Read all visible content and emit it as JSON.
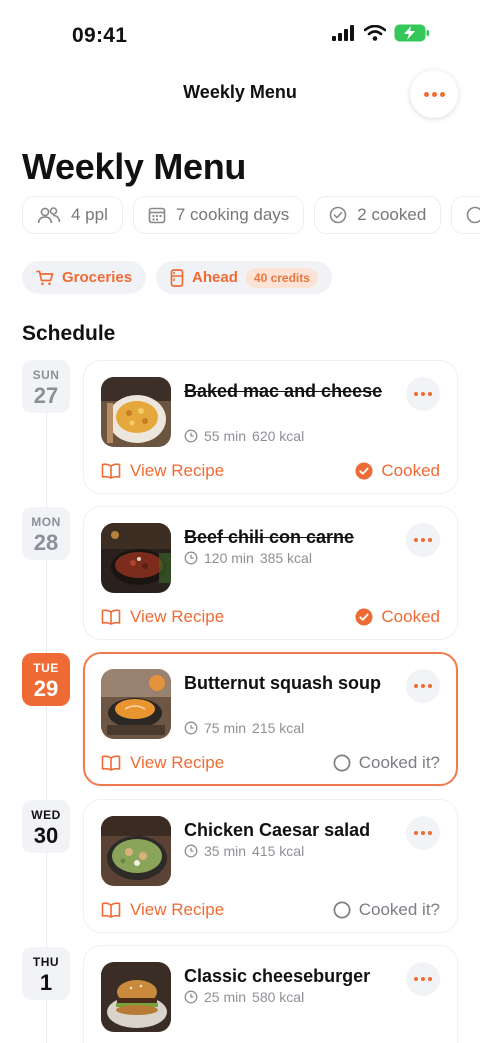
{
  "status_bar": {
    "time": "09:41"
  },
  "nav": {
    "title": "Weekly Menu"
  },
  "page": {
    "title": "Weekly Menu"
  },
  "stats": [
    {
      "icon": "people-icon",
      "label": "4 ppl"
    },
    {
      "icon": "calendar-icon",
      "label": "7 cooking days"
    },
    {
      "icon": "check-circle-icon",
      "label": "2 cooked"
    }
  ],
  "actions": {
    "groceries": "Groceries",
    "ahead": "Ahead",
    "ahead_badge": "40 credits"
  },
  "schedule": {
    "title": "Schedule",
    "view_recipe_label": "View Recipe",
    "cooked_label": "Cooked",
    "cooked_it_label": "Cooked it?",
    "days": [
      {
        "day": "SUN",
        "date": "27",
        "name": "Baked mac and cheese",
        "time": "55 min",
        "kcal": "620 kcal",
        "status": "cooked"
      },
      {
        "day": "MON",
        "date": "28",
        "name": "Beef chili con carne",
        "time": "120 min",
        "kcal": "385 kcal",
        "status": "cooked"
      },
      {
        "day": "TUE",
        "date": "29",
        "name": "Butternut squash soup",
        "time": "75 min",
        "kcal": "215 kcal",
        "status": "pending"
      },
      {
        "day": "WED",
        "date": "30",
        "name": "Chicken Caesar salad",
        "time": "35 min",
        "kcal": "415 kcal",
        "status": "pending"
      },
      {
        "day": "THU",
        "date": "1",
        "name": "Classic cheeseburger",
        "time": "25 min",
        "kcal": "580 kcal",
        "status": "pending"
      }
    ]
  },
  "colors": {
    "accent": "#ef6b35",
    "muted": "#8e9096",
    "chip_bg": "#f1f2f6"
  }
}
